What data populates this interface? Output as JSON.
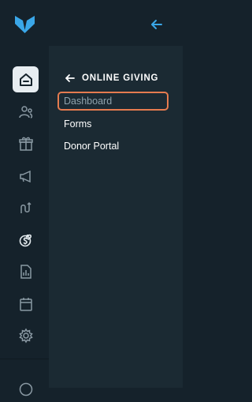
{
  "nav": {
    "rail": [
      {
        "icon": "home-icon",
        "active": true
      },
      {
        "icon": "people-icon"
      },
      {
        "icon": "gift-icon"
      },
      {
        "icon": "megaphone-icon"
      },
      {
        "icon": "route-icon"
      },
      {
        "icon": "donation-icon"
      },
      {
        "icon": "report-icon"
      },
      {
        "icon": "calendar-icon"
      },
      {
        "icon": "settings-icon"
      }
    ]
  },
  "panel": {
    "title": "ONLINE GIVING",
    "items": [
      {
        "label": "Dashboard",
        "highlighted": true
      },
      {
        "label": "Forms"
      },
      {
        "label": "Donor Portal"
      }
    ]
  },
  "colors": {
    "background": "#15222b",
    "panel": "#1b2a33",
    "accent_blue": "#3aa7e8",
    "highlight_border": "#e57b4f"
  }
}
